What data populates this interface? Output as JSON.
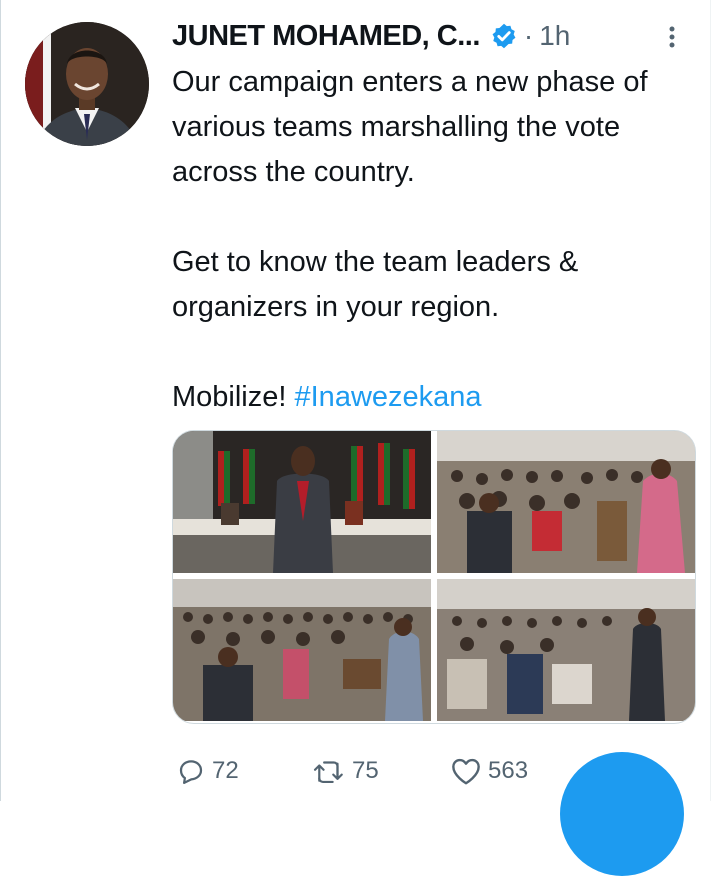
{
  "tweet": {
    "author_name": "JUNET MOHAMED, C...",
    "separator": "·",
    "time": "1h",
    "text_main": "Our campaign enters a new phase of various teams marshalling the vote across the country.\n\nGet to know the team leaders & organizers in your region.\n\nMobilize! ",
    "hashtag": "#Inawezekana"
  },
  "actions": {
    "replies": "72",
    "retweets": "75",
    "likes": "563"
  },
  "icons": {
    "verified": "verified-badge-icon",
    "more": "more-options-icon",
    "reply": "reply-icon",
    "retweet": "retweet-icon",
    "like": "heart-icon"
  },
  "colors": {
    "accent": "#1d9bf0",
    "text": "#0f1419",
    "muted": "#536471"
  }
}
